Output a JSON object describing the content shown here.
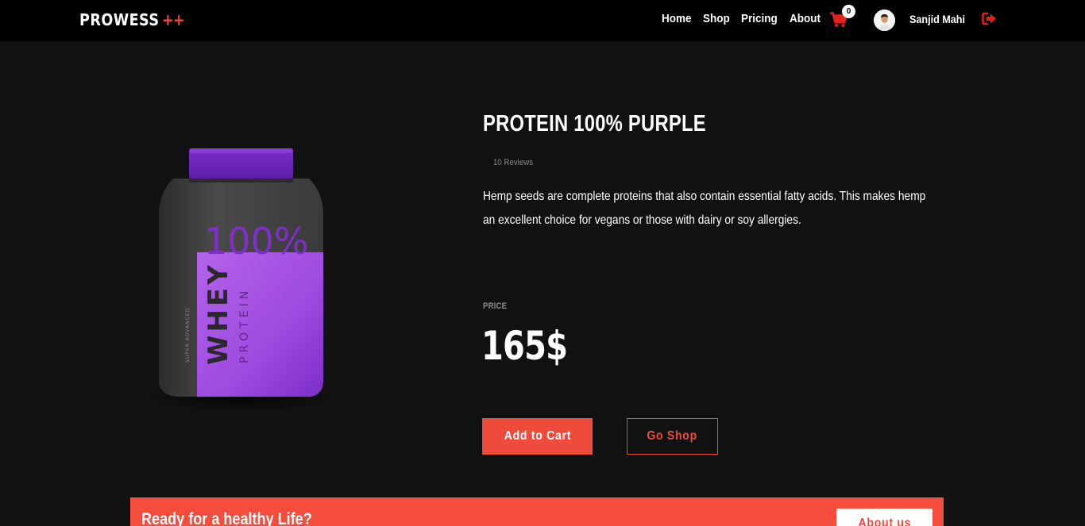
{
  "brand": {
    "name": "PROWESS",
    "suffix": "++"
  },
  "nav": {
    "links": [
      "Home",
      "Shop",
      "Pricing",
      "About"
    ],
    "cart_count": "0",
    "user_name": "Sanjid Mahi"
  },
  "product": {
    "title": "PROTEIN 100% PURPLE",
    "reviews": "10 Reviews",
    "description": "Hemp seeds are complete proteins that also contain essential fatty acids. This makes hemp an excellent choice for vegans or those with dairy or soy allergies.",
    "price_label": "PRICE",
    "price": "165$",
    "image": {
      "percent_text": "100%",
      "brand_text": "WHEY",
      "sub_text": "PROTEIN",
      "tag_text": "SUPER ADVANCED"
    }
  },
  "actions": {
    "add_to_cart": "Add to Cart",
    "go_shop": "Go Shop"
  },
  "banner": {
    "text": "Ready for a healthy Life?",
    "button": "About us"
  },
  "colors": {
    "accent": "#ef4b3c",
    "background": "#111111",
    "navbar": "#000000",
    "jar_purple": "#a24fe0",
    "lid_purple": "#6a22b5"
  },
  "icons": {
    "cart": "cart-icon",
    "logout": "logout-icon",
    "avatar": "avatar"
  }
}
